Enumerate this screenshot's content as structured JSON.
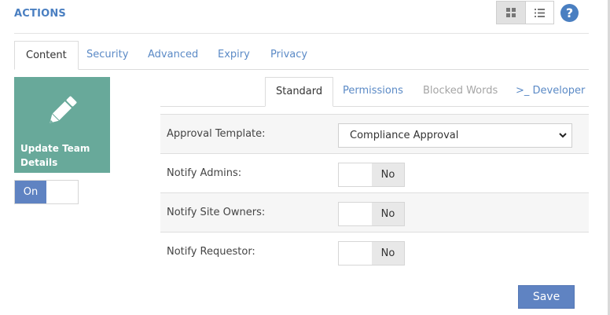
{
  "header": {
    "title": "ACTIONS",
    "view_toggle": {
      "active": "grid",
      "options": [
        "grid-view-icon",
        "list-view-icon"
      ]
    },
    "help_label": "?"
  },
  "main_tabs": [
    {
      "label": "Content",
      "active": true
    },
    {
      "label": "Security",
      "active": false
    },
    {
      "label": "Advanced",
      "active": false
    },
    {
      "label": "Expiry",
      "active": false
    },
    {
      "label": "Privacy",
      "active": false
    }
  ],
  "action_tile": {
    "label": "Update Team Details",
    "icon": "pencil-icon",
    "color": "#68a99a",
    "toggle_value": "On"
  },
  "sub_tabs": [
    {
      "label": "Standard",
      "active": true
    },
    {
      "label": "Permissions",
      "active": false
    },
    {
      "label": "Blocked Words",
      "disabled": true
    },
    {
      "label": ">_ Developer",
      "active": false
    }
  ],
  "settings": {
    "approval_template": {
      "label": "Approval Template:",
      "value": "Compliance Approval"
    },
    "notify_admins": {
      "label": "Notify Admins:",
      "value": "No"
    },
    "notify_site_owners": {
      "label": "Notify Site Owners:",
      "value": "No"
    },
    "notify_requestor": {
      "label": "Notify Requestor:",
      "value": "No"
    }
  },
  "save_label": "Save",
  "colors": {
    "accent": "#5f83c2",
    "link": "#5b8ac6",
    "tile": "#68a99a"
  }
}
